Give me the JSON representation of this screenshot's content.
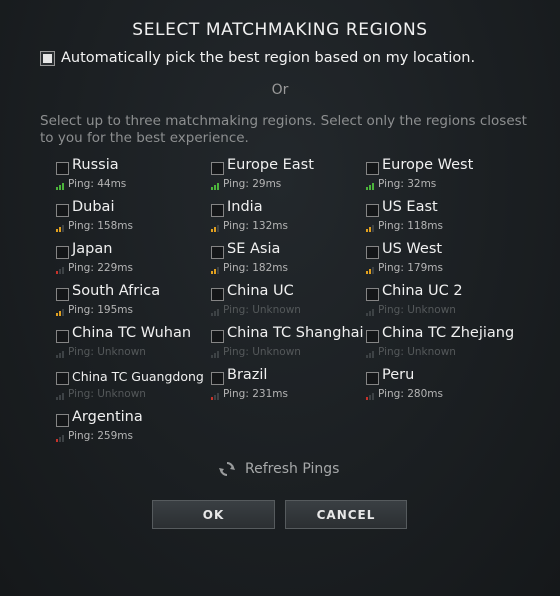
{
  "title": "SELECT MATCHMAKING REGIONS",
  "auto_pick": {
    "label": "Automatically pick the best region based on my location.",
    "checked": true
  },
  "or_text": "Or",
  "description": "Select up to three matchmaking regions. Select only the regions closest to you for the best experience.",
  "colors": {
    "good": "#4cb43c",
    "medium": "#e0a020",
    "bad": "#c8322a",
    "unknown": "#3d4245"
  },
  "regions": [
    {
      "name": "Russia",
      "ping": "Ping: 44ms",
      "quality": "good"
    },
    {
      "name": "Europe East",
      "ping": "Ping: 29ms",
      "quality": "good"
    },
    {
      "name": "Europe West",
      "ping": "Ping: 32ms",
      "quality": "good"
    },
    {
      "name": "Dubai",
      "ping": "Ping: 158ms",
      "quality": "medium"
    },
    {
      "name": "India",
      "ping": "Ping: 132ms",
      "quality": "medium"
    },
    {
      "name": "US East",
      "ping": "Ping: 118ms",
      "quality": "medium"
    },
    {
      "name": "Japan",
      "ping": "Ping: 229ms",
      "quality": "bad"
    },
    {
      "name": "SE Asia",
      "ping": "Ping: 182ms",
      "quality": "medium"
    },
    {
      "name": "US West",
      "ping": "Ping: 179ms",
      "quality": "medium"
    },
    {
      "name": "South Africa",
      "ping": "Ping: 195ms",
      "quality": "medium"
    },
    {
      "name": "China UC",
      "ping": "Ping: Unknown",
      "quality": "unknown"
    },
    {
      "name": "China UC 2",
      "ping": "Ping: Unknown",
      "quality": "unknown"
    },
    {
      "name": "China TC Wuhan",
      "ping": "Ping: Unknown",
      "quality": "unknown"
    },
    {
      "name": "China TC Shanghai",
      "ping": "Ping: Unknown",
      "quality": "unknown"
    },
    {
      "name": "China TC Zhejiang",
      "ping": "Ping: Unknown",
      "quality": "unknown"
    },
    {
      "name": "China TC Guangdong",
      "ping": "Ping: Unknown",
      "quality": "unknown"
    },
    {
      "name": "Brazil",
      "ping": "Ping: 231ms",
      "quality": "bad"
    },
    {
      "name": "Peru",
      "ping": "Ping: 280ms",
      "quality": "bad"
    },
    {
      "name": "Argentina",
      "ping": "Ping: 259ms",
      "quality": "bad"
    }
  ],
  "refresh": {
    "label": "Refresh Pings",
    "icon": "refresh-icon"
  },
  "buttons": {
    "ok": "OK",
    "cancel": "CANCEL"
  }
}
